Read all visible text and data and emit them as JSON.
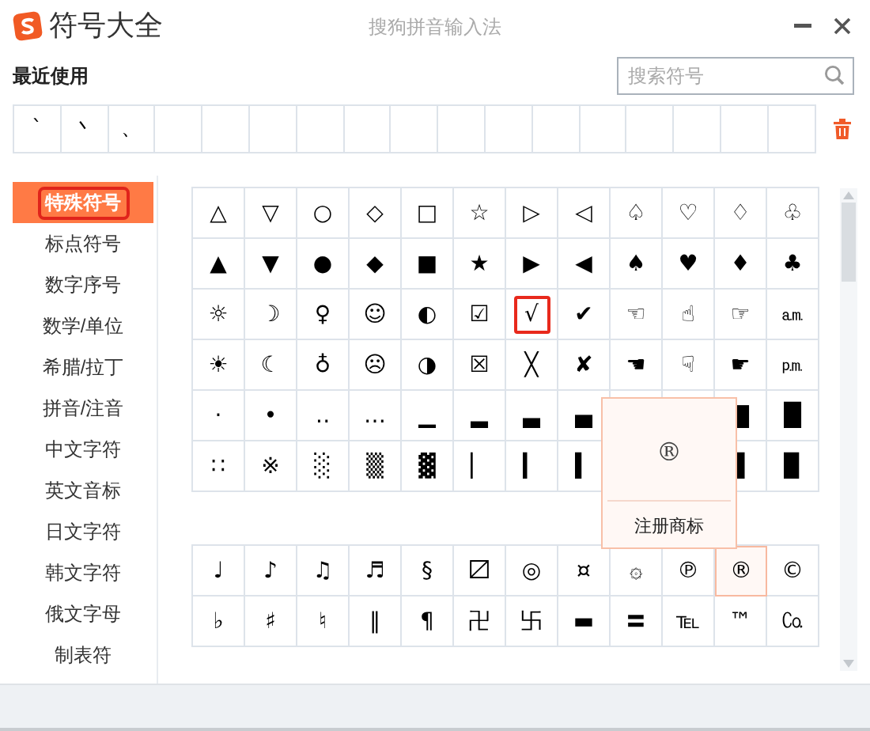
{
  "window": {
    "title": "符号大全",
    "app_name": "搜狗拼音输入法"
  },
  "recent": {
    "title": "最近使用",
    "symbols": [
      "ˋ",
      "丶",
      "、"
    ]
  },
  "search": {
    "placeholder": "搜索符号"
  },
  "categories": [
    {
      "label": "特殊符号",
      "selected": true
    },
    {
      "label": "标点符号",
      "selected": false
    },
    {
      "label": "数字序号",
      "selected": false
    },
    {
      "label": "数学/单位",
      "selected": false
    },
    {
      "label": "希腊/拉丁",
      "selected": false
    },
    {
      "label": "拼音/注音",
      "selected": false
    },
    {
      "label": "中文字符",
      "selected": false
    },
    {
      "label": "英文音标",
      "selected": false
    },
    {
      "label": "日文字符",
      "selected": false
    },
    {
      "label": "韩文字符",
      "selected": false
    },
    {
      "label": "俄文字母",
      "selected": false
    },
    {
      "label": "制表符",
      "selected": false
    }
  ],
  "symbol_groups": [
    {
      "rows": [
        [
          {
            "symbol": "△",
            "selected": false,
            "hovered": false
          },
          {
            "symbol": "▽",
            "selected": false,
            "hovered": false
          },
          {
            "symbol": "○",
            "selected": false,
            "hovered": false
          },
          {
            "symbol": "◇",
            "selected": false,
            "hovered": false
          },
          {
            "symbol": "□",
            "selected": false,
            "hovered": false
          },
          {
            "symbol": "☆",
            "selected": false,
            "hovered": false
          },
          {
            "symbol": "▷",
            "selected": false,
            "hovered": false
          },
          {
            "symbol": "◁",
            "selected": false,
            "hovered": false
          },
          {
            "symbol": "♤",
            "selected": false,
            "hovered": false
          },
          {
            "symbol": "♡",
            "selected": false,
            "hovered": false
          },
          {
            "symbol": "♢",
            "selected": false,
            "hovered": false
          },
          {
            "symbol": "♧",
            "selected": false,
            "hovered": false
          }
        ],
        [
          {
            "symbol": "▲",
            "selected": false,
            "hovered": false
          },
          {
            "symbol": "▼",
            "selected": false,
            "hovered": false
          },
          {
            "symbol": "●",
            "selected": false,
            "hovered": false
          },
          {
            "symbol": "◆",
            "selected": false,
            "hovered": false
          },
          {
            "symbol": "■",
            "selected": false,
            "hovered": false
          },
          {
            "symbol": "★",
            "selected": false,
            "hovered": false
          },
          {
            "symbol": "▶",
            "selected": false,
            "hovered": false
          },
          {
            "symbol": "◀",
            "selected": false,
            "hovered": false
          },
          {
            "symbol": "♠",
            "selected": false,
            "hovered": false
          },
          {
            "symbol": "♥",
            "selected": false,
            "hovered": false
          },
          {
            "symbol": "♦",
            "selected": false,
            "hovered": false
          },
          {
            "symbol": "♣",
            "selected": false,
            "hovered": false
          }
        ],
        [
          {
            "symbol": "☼",
            "selected": false,
            "hovered": false
          },
          {
            "symbol": "☽",
            "selected": false,
            "hovered": false
          },
          {
            "symbol": "♀",
            "selected": false,
            "hovered": false
          },
          {
            "symbol": "☺",
            "selected": false,
            "hovered": false
          },
          {
            "symbol": "◐",
            "selected": false,
            "hovered": false
          },
          {
            "symbol": "☑",
            "selected": false,
            "hovered": false
          },
          {
            "symbol": "√",
            "selected": true,
            "hovered": false
          },
          {
            "symbol": "✔",
            "selected": false,
            "hovered": false
          },
          {
            "symbol": "☜",
            "selected": false,
            "hovered": false
          },
          {
            "symbol": "☝",
            "selected": false,
            "hovered": false
          },
          {
            "symbol": "☞",
            "selected": false,
            "hovered": false
          },
          {
            "symbol": "㏂",
            "selected": false,
            "hovered": false
          }
        ],
        [
          {
            "symbol": "☀",
            "selected": false,
            "hovered": false
          },
          {
            "symbol": "☾",
            "selected": false,
            "hovered": false
          },
          {
            "symbol": "♁",
            "selected": false,
            "hovered": false
          },
          {
            "symbol": "☹",
            "selected": false,
            "hovered": false
          },
          {
            "symbol": "◑",
            "selected": false,
            "hovered": false
          },
          {
            "symbol": "☒",
            "selected": false,
            "hovered": false
          },
          {
            "symbol": "╳",
            "selected": false,
            "hovered": false
          },
          {
            "symbol": "✘",
            "selected": false,
            "hovered": false
          },
          {
            "symbol": "☚",
            "selected": false,
            "hovered": false
          },
          {
            "symbol": "☟",
            "selected": false,
            "hovered": false
          },
          {
            "symbol": "☛",
            "selected": false,
            "hovered": false
          },
          {
            "symbol": "㏘",
            "selected": false,
            "hovered": false
          }
        ],
        [
          {
            "symbol": "·",
            "selected": false,
            "hovered": false
          },
          {
            "symbol": "•",
            "selected": false,
            "hovered": false
          },
          {
            "symbol": "‥",
            "selected": false,
            "hovered": false
          },
          {
            "symbol": "…",
            "selected": false,
            "hovered": false
          },
          {
            "symbol": "▁",
            "selected": false,
            "hovered": false
          },
          {
            "symbol": "▂",
            "selected": false,
            "hovered": false
          },
          {
            "symbol": "▃",
            "selected": false,
            "hovered": false
          },
          {
            "symbol": "▄",
            "selected": false,
            "hovered": false
          },
          {
            "symbol": "▇",
            "selected": false,
            "hovered": false
          },
          {
            "symbol": "█",
            "selected": false,
            "hovered": false
          }
        ],
        [
          {
            "symbol": "∷",
            "selected": false,
            "hovered": false
          },
          {
            "symbol": "※",
            "selected": false,
            "hovered": false
          },
          {
            "symbol": "░",
            "selected": false,
            "hovered": false
          },
          {
            "symbol": "▒",
            "selected": false,
            "hovered": false
          },
          {
            "symbol": "▓",
            "selected": false,
            "hovered": false
          },
          {
            "symbol": "▏",
            "selected": false,
            "hovered": false
          },
          {
            "symbol": "▎",
            "selected": false,
            "hovered": false
          },
          {
            "symbol": "▍",
            "selected": false,
            "hovered": false
          },
          {
            "symbol": "▊",
            "selected": false,
            "hovered": false
          },
          {
            "symbol": "▉",
            "selected": false,
            "hovered": false
          }
        ]
      ]
    },
    {
      "rows": [
        [
          {
            "symbol": "♩",
            "selected": false,
            "hovered": false
          },
          {
            "symbol": "♪",
            "selected": false,
            "hovered": false
          },
          {
            "symbol": "♫",
            "selected": false,
            "hovered": false
          },
          {
            "symbol": "♬",
            "selected": false,
            "hovered": false
          },
          {
            "symbol": "§",
            "selected": false,
            "hovered": false
          },
          {
            "symbol": "〼",
            "selected": false,
            "hovered": false
          },
          {
            "symbol": "◎",
            "selected": false,
            "hovered": false
          },
          {
            "symbol": "¤",
            "selected": false,
            "hovered": false
          },
          {
            "symbol": "۞",
            "selected": false,
            "hovered": false
          },
          {
            "symbol": "℗",
            "selected": false,
            "hovered": false
          },
          {
            "symbol": "®",
            "selected": false,
            "hovered": true
          },
          {
            "symbol": "©",
            "selected": false,
            "hovered": false
          }
        ],
        [
          {
            "symbol": "♭",
            "selected": false,
            "hovered": false
          },
          {
            "symbol": "♯",
            "selected": false,
            "hovered": false
          },
          {
            "symbol": "♮",
            "selected": false,
            "hovered": false
          },
          {
            "symbol": "‖",
            "selected": false,
            "hovered": false
          },
          {
            "symbol": "¶",
            "selected": false,
            "hovered": false
          },
          {
            "symbol": "卍",
            "selected": false,
            "hovered": false
          },
          {
            "symbol": "卐",
            "selected": false,
            "hovered": false
          },
          {
            "symbol": "▬",
            "selected": false,
            "hovered": false
          },
          {
            "symbol": "〓",
            "selected": false,
            "hovered": false
          },
          {
            "symbol": "℡",
            "selected": false,
            "hovered": false
          },
          {
            "symbol": "™",
            "selected": false,
            "hovered": false
          },
          {
            "symbol": "㏇",
            "selected": false,
            "hovered": false
          }
        ]
      ]
    }
  ],
  "preview": {
    "symbol": "®",
    "label": "注册商标"
  }
}
